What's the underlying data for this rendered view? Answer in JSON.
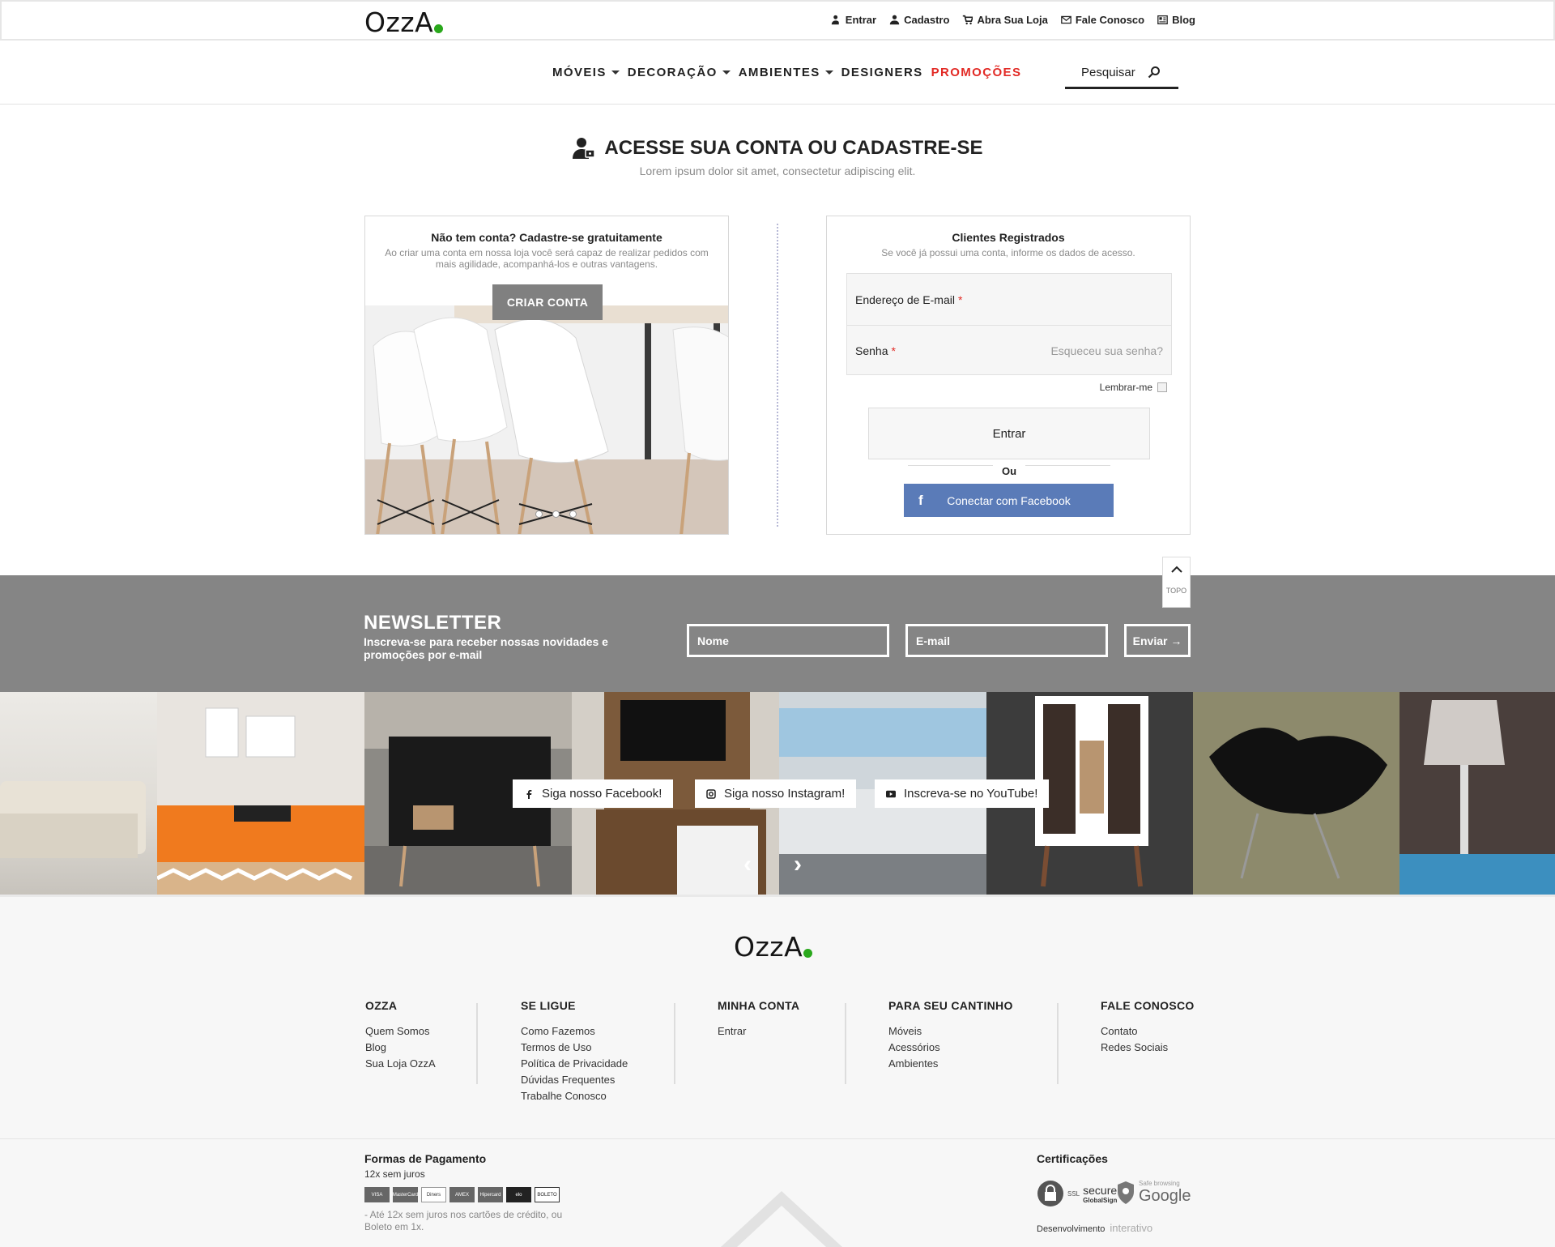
{
  "brand": {
    "logo_text": "OzzA",
    "accent": "#2aa81c",
    "promo_color": "#e22a25"
  },
  "topbar": {
    "links": [
      {
        "label": "Entrar",
        "icon": "user-lock-icon"
      },
      {
        "label": "Cadastro",
        "icon": "user-icon"
      },
      {
        "label": "Abra Sua Loja",
        "icon": "cart-icon"
      },
      {
        "label": "Fale Conosco",
        "icon": "mail-icon"
      },
      {
        "label": "Blog",
        "icon": "newspaper-icon"
      }
    ]
  },
  "nav": {
    "items": [
      {
        "label": "MÓVEIS"
      },
      {
        "label": "DECORAÇÃO"
      },
      {
        "label": "AMBIENTES"
      },
      {
        "label": "DESIGNERS"
      },
      {
        "label": "PROMOÇÕES"
      }
    ],
    "search_label": "Pesquisar"
  },
  "page": {
    "title": "ACESSE SUA CONTA OU CADASTRE-SE",
    "subtitle": "Lorem ipsum dolor sit amet, consectetur adipiscing elit."
  },
  "register": {
    "heading": "Não tem conta? Cadastre-se gratuitamente",
    "desc": "Ao criar uma conta em nossa loja você será capaz de realizar pedidos com mais agilidade, acompanhá-los e outras vantagens.",
    "button": "CRIAR CONTA"
  },
  "login": {
    "heading": "Clientes Registrados",
    "desc": "Se você já possui uma conta, informe os dados de acesso.",
    "email_label": "Endereço de E-mail",
    "password_label": "Senha",
    "required_mark": "*",
    "forgot": "Esqueceu sua senha?",
    "remember": "Lembrar-me",
    "submit": "Entrar",
    "or": "Ou",
    "facebook": "Conectar com Facebook"
  },
  "newsletter": {
    "title": "NEWSLETTER",
    "subtitle": "Inscreva-se para receber nossas novidades e promoções por e-mail",
    "name_placeholder": "Nome",
    "email_placeholder": "E-mail",
    "send": "Enviar →",
    "top_label": "TOPO"
  },
  "social": {
    "facebook": "Siga nosso Facebook!",
    "instagram": "Siga nosso Instagram!",
    "youtube": "Inscreva-se no YouTube!"
  },
  "footer": {
    "columns": [
      {
        "title": "OZZA",
        "links": [
          "Quem Somos",
          "Blog",
          "Sua Loja OzzA"
        ]
      },
      {
        "title": "SE LIGUE",
        "links": [
          "Como Fazemos",
          "Termos de Uso",
          "Política de Privacidade",
          "Dúvidas Frequentes",
          "Trabalhe Conosco"
        ]
      },
      {
        "title": "MINHA CONTA",
        "links": [
          "Entrar"
        ]
      },
      {
        "title": "PARA SEU CANTINHO",
        "links": [
          "Móveis",
          "Acessórios",
          "Ambientes"
        ]
      },
      {
        "title": "FALE CONOSCO",
        "links": [
          "Contato",
          "Redes Sociais"
        ]
      }
    ]
  },
  "payment": {
    "title": "Formas de Pagamento",
    "subtitle": "12x sem juros",
    "cards": [
      "VISA",
      "MasterCard",
      "Diners",
      "AMEX",
      "Hipercard",
      "elo",
      "BOLETO"
    ],
    "note": "- Até 12x sem juros nos cartões de crédito, ou Boleto em 1x."
  },
  "certs": {
    "title": "Certificações",
    "ssl": "secure",
    "ssl_sub": "GlobalSign",
    "ssl_badge": "SSL",
    "google_small": "Safe browsing",
    "google": "Google",
    "dev_label": "Desenvolvimento",
    "dev_name": "interativo"
  }
}
